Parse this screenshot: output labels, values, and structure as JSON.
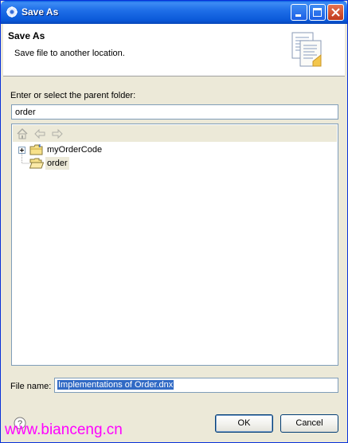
{
  "window": {
    "title": "Save As",
    "controls": [
      "minimize-icon",
      "maximize-icon",
      "close-icon"
    ]
  },
  "header": {
    "title": "Save As",
    "description": "Save file to another location.",
    "icon": "documents-icon"
  },
  "parent_folder": {
    "label": "Enter or select the parent folder:",
    "value": "order"
  },
  "tree": {
    "toolbar_icons": [
      "home-icon",
      "back-icon",
      "forward-icon"
    ],
    "items": [
      {
        "label": "myOrderCode",
        "expander": "+",
        "icon": "folder-icon"
      },
      {
        "label": "order",
        "icon": "folder-open-icon",
        "selected": true
      }
    ]
  },
  "file_name": {
    "label": "File name:",
    "value": "Implementations of Order.dnx"
  },
  "buttons": {
    "ok": "OK",
    "cancel": "Cancel"
  },
  "watermark": "www.bianceng.cn",
  "colors": {
    "titlebar": "#0a58d8",
    "dialog_bg": "#ece9d8",
    "selection": "#316ac5",
    "watermark": "#ff00ff"
  }
}
